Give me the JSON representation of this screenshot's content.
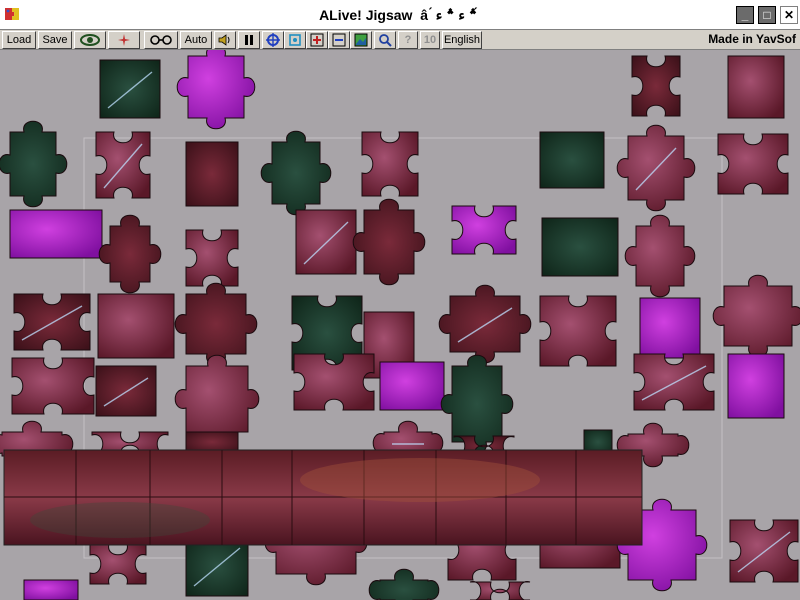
{
  "window": {
    "title": "ALive! Jigsaw  âˆ‘â€š: â€¦ â€ž",
    "title_display": "ALive! Jigsaw  â ́ ؞ ء ؞ ء ́",
    "icon": "app-jigsaw-icon",
    "controls": [
      "minimize-icon",
      "maximize-icon",
      "close-icon"
    ]
  },
  "toolbar": {
    "load_label": "Load",
    "save_label": "Save",
    "eye_icon": "eye-icon",
    "sparkle_icon": "sparkle-icon",
    "glasses_icon": "glasses-icon",
    "auto_label": "Auto",
    "sound_icon": "speaker-icon",
    "pause_icon": "pause-icon",
    "move_icon": "move-icon",
    "center_icon": "center-icon",
    "plus_icon": "zoom-in-frame-icon",
    "minus_icon": "zoom-out-frame-icon",
    "picture_icon": "picture-icon",
    "magnify_icon": "magnify-icon",
    "help_label": "?",
    "count_label": "10",
    "language_label": "English",
    "made_in": "Made in YavSof"
  },
  "board": {
    "background": "#a8a4a8",
    "frame_outline": "#c4c0c4"
  },
  "colors": {
    "piece_dark_red": "#6a1e2e",
    "piece_mauve": "#8a3a52",
    "piece_rose": "#9c4a62",
    "piece_magenta": "#b024c4",
    "piece_dark_green": "#1a3a2a",
    "piece_brown": "#6a2a24"
  }
}
